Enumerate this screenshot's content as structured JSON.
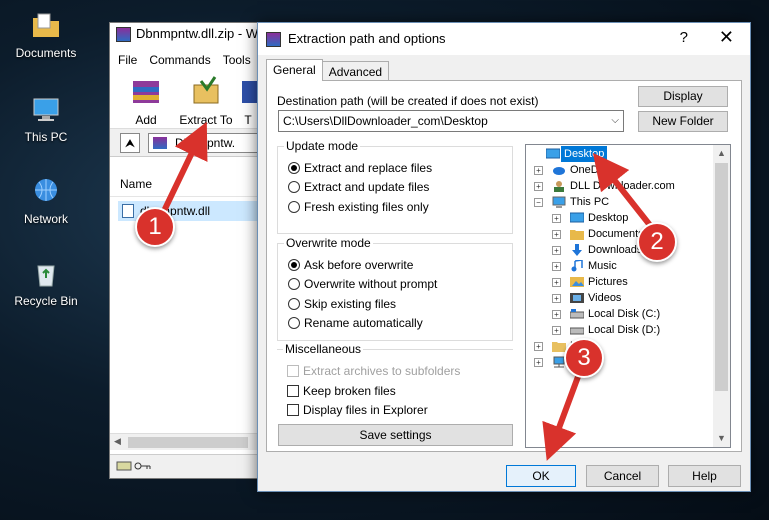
{
  "desktop": {
    "icons": [
      {
        "label": "Documents",
        "icon": "documents-folder-icon"
      },
      {
        "label": "This PC",
        "icon": "computer-icon"
      },
      {
        "label": "Network",
        "icon": "network-icon"
      },
      {
        "label": "Recycle Bin",
        "icon": "recycle-bin-icon"
      }
    ]
  },
  "winrar": {
    "title": "Dbnmpntw.dll.zip - W",
    "menu": [
      "File",
      "Commands",
      "Tools"
    ],
    "toolbar": {
      "add_label": "Add",
      "extract_label": "Extract To",
      "third_label": "T"
    },
    "address": "Dbnmpntw.",
    "up_glyph": "⮝",
    "column_name": "Name",
    "selected_file": "dbnmpntw.dll"
  },
  "dialog": {
    "title": "Extraction path and options",
    "help": "?",
    "close": "✕",
    "tabs": [
      "General",
      "Advanced"
    ],
    "destination_label": "Destination path (will be created if does not exist)",
    "destination_value": "C:\\Users\\DllDownloader_com\\Desktop",
    "display_button": "Display",
    "new_folder_button": "New Folder",
    "update_mode": {
      "title": "Update mode",
      "options": [
        "Extract and replace files",
        "Extract and update files",
        "Fresh existing files only"
      ],
      "selected": 0
    },
    "overwrite_mode": {
      "title": "Overwrite mode",
      "options": [
        "Ask before overwrite",
        "Overwrite without prompt",
        "Skip existing files",
        "Rename automatically"
      ],
      "selected": 0
    },
    "misc": {
      "title": "Miscellaneous",
      "options": [
        "Extract archives to subfolders",
        "Keep broken files",
        "Display files in Explorer"
      ]
    },
    "save_settings_button": "Save settings",
    "ok_button": "OK",
    "cancel_button": "Cancel",
    "help_button": "Help",
    "tree": [
      {
        "label": "Desktop",
        "icon": "desktop-icon",
        "selected": true
      },
      {
        "label": "OneD",
        "icon": "onedrive-icon"
      },
      {
        "label": "DLL Downloader.com",
        "icon": "user-icon"
      },
      {
        "label": "This PC",
        "icon": "computer-icon"
      },
      {
        "label": "Desktop",
        "icon": "desktop-icon"
      },
      {
        "label": "Documents",
        "icon": "documents-folder-icon"
      },
      {
        "label": "Downloads",
        "icon": "downloads-icon"
      },
      {
        "label": "Music",
        "icon": "music-icon"
      },
      {
        "label": "Pictures",
        "icon": "pictures-icon"
      },
      {
        "label": "Videos",
        "icon": "videos-icon"
      },
      {
        "label": "Local Disk (C:)",
        "icon": "drive-icon"
      },
      {
        "label": "Local Disk (D:)",
        "icon": "drive-icon"
      },
      {
        "label": "Li",
        "icon": "libraries-folder-icon"
      },
      {
        "label": "k",
        "icon": "network-icon"
      }
    ]
  },
  "annotations": {
    "step1": "1",
    "step2": "2",
    "step3": "3"
  },
  "colors": {
    "marker": "#d9322c",
    "selection": "#0078d7",
    "accent_border": "#6b8fb5"
  }
}
